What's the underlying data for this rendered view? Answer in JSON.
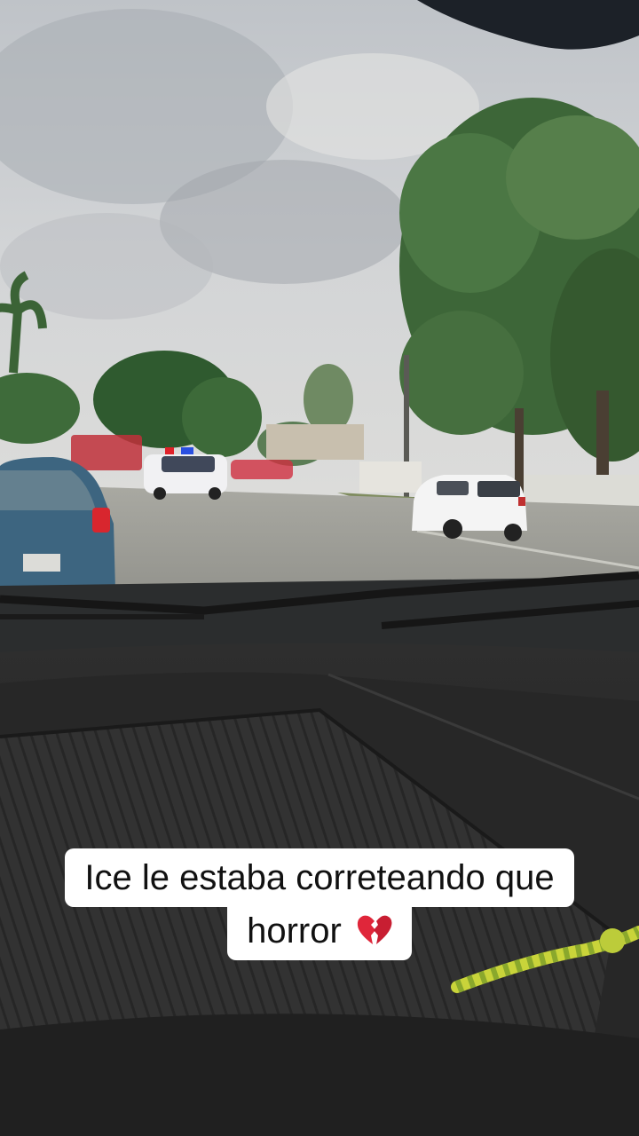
{
  "caption": {
    "line1": "Ice le estaba correteando que",
    "line2": "horror",
    "emoji_icon": "broken-heart-icon"
  },
  "colors": {
    "sky": "#c9ccd0",
    "foliage": "#3f6a3a",
    "road": "#9a9a94",
    "dashboard": "#2a2a2a",
    "caption_bg": "#ffffff",
    "caption_text": "#111111",
    "police_red": "#e0222a",
    "police_blue": "#2a4fe0",
    "toy_yellow": "#c9d43a"
  }
}
